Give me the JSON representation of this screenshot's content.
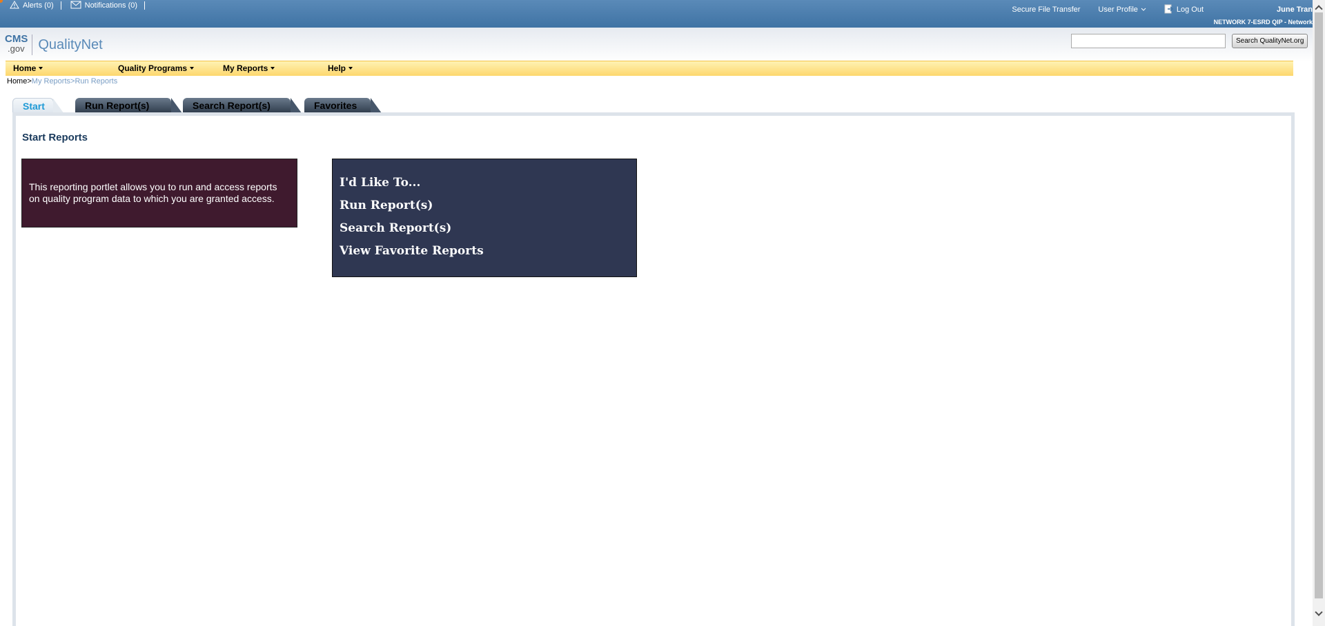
{
  "topbar": {
    "alerts": "Alerts (0)",
    "notifications": "Notifications (0)",
    "secure_file_transfer": "Secure File Transfer",
    "user_profile": "User Profile",
    "log_out": "Log Out",
    "user_name": "June Tran",
    "network": "NETWORK 7-ESRD QIP - Network"
  },
  "header": {
    "logo_cms": "CMS",
    "logo_gov": ".gov",
    "logo_qualitynet": "QualityNet",
    "search_placeholder": "",
    "search_button": "Search QualityNet.org"
  },
  "nav": {
    "items": [
      {
        "label": "Home"
      },
      {
        "label": "Quality Programs"
      },
      {
        "label": "My Reports"
      },
      {
        "label": "Help"
      }
    ]
  },
  "breadcrumb": {
    "home": "Home",
    "sep": ">",
    "my_reports": "My Reports",
    "run_reports": "Run Reports"
  },
  "tabs": [
    {
      "label": "Start",
      "active": true
    },
    {
      "label": "Run Report(s)",
      "active": false
    },
    {
      "label": "Search Report(s)",
      "active": false
    },
    {
      "label": "Favorites",
      "active": false
    }
  ],
  "main": {
    "title": "Start Reports",
    "info_text": "This reporting portlet allows you to run and access reports on quality program data to which you are granted access.",
    "like_heading": "I'd Like To...",
    "links": [
      {
        "label": "Run Report(s)"
      },
      {
        "label": "Search Report(s)"
      },
      {
        "label": "View Favorite Reports"
      }
    ]
  },
  "colors": {
    "topbar": "#3f73a4",
    "nav": "#fdd76d",
    "info_box": "#3f1a2e",
    "like_box": "#2f3752",
    "active_tab_text": "#1e9ad6"
  }
}
